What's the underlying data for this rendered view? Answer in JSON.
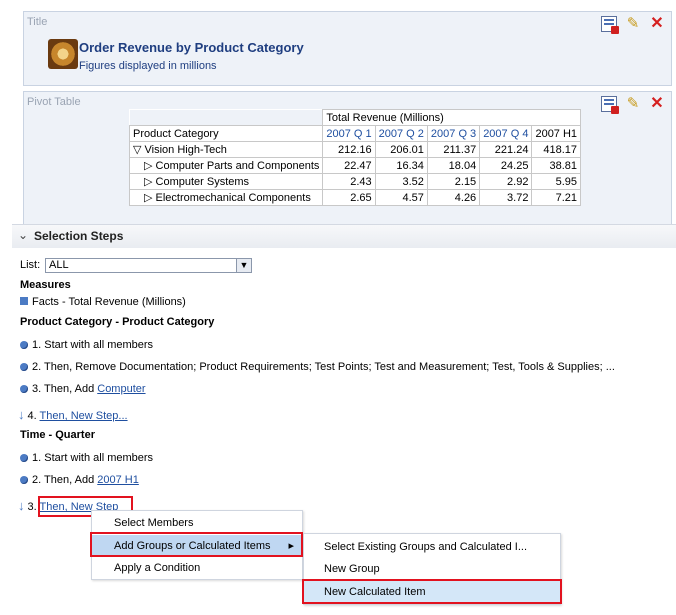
{
  "title_panel": {
    "label": "Title",
    "title": "Order Revenue by Product Category",
    "subtitle": "Figures displayed in millions"
  },
  "pivot_panel": {
    "label": "Pivot Table",
    "measure_header": "Total Revenue (Millions)",
    "row_header": "Product Category",
    "columns": [
      "2007 Q 1",
      "2007 Q 2",
      "2007 Q 3",
      "2007 Q 4",
      "2007 H1"
    ],
    "rows": [
      {
        "label": "▽ Vision High-Tech",
        "values": [
          "212.16",
          "206.01",
          "211.37",
          "221.24",
          "418.17"
        ]
      },
      {
        "label": "▷ Computer Parts and Components",
        "values": [
          "22.47",
          "16.34",
          "18.04",
          "24.25",
          "38.81"
        ]
      },
      {
        "label": "▷ Computer Systems",
        "values": [
          "2.43",
          "3.52",
          "2.15",
          "2.92",
          "5.95"
        ]
      },
      {
        "label": "▷ Electromechanical Components",
        "values": [
          "2.65",
          "4.57",
          "4.26",
          "3.72",
          "7.21"
        ]
      }
    ]
  },
  "selection_steps": {
    "title": "Selection Steps",
    "list_label": "List:",
    "list_value": "ALL",
    "measures_heading": "Measures",
    "measures_item": "Facts - Total Revenue (Millions)",
    "product_heading": "Product Category - Product Category",
    "product_steps": [
      "1. Start with all members",
      "2. Then, Remove Documentation; Product Requirements; Test Points; Test and Measurement; Test, Tools & Supplies; ...",
      "3. Then, Add ",
      "4. "
    ],
    "product_step3_link": "Computer",
    "product_step4_link": "Then, New Step...",
    "time_heading": "Time - Quarter",
    "time_steps": [
      "1. Start with all members",
      "2. Then, Add ",
      "3. "
    ],
    "time_step2_link": "2007 H1",
    "time_step3_link": "Then, New Step"
  },
  "context_menu": {
    "items": [
      "Select Members",
      "Add Groups or Calculated Items",
      "Apply a Condition"
    ],
    "submenu_arrow": "▸"
  },
  "submenu": {
    "items": [
      "Select Existing Groups and Calculated I...",
      "New Group",
      "New Calculated Item"
    ]
  },
  "icons": {
    "properties": "properties-icon",
    "edit": "pencil-icon",
    "delete": "close-icon"
  }
}
